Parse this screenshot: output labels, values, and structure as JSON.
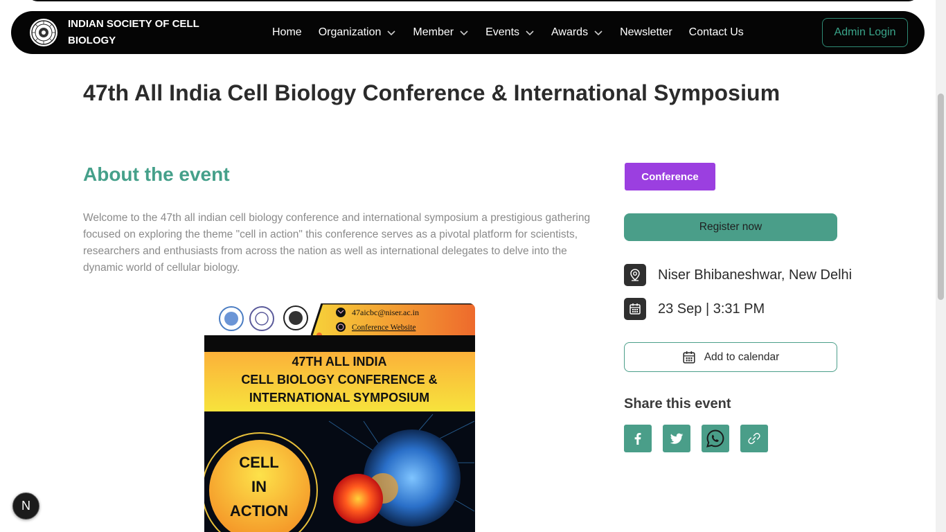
{
  "header": {
    "brand_name": "INDIAN SOCIETY OF CELL BIOLOGY",
    "nav": [
      {
        "label": "Home",
        "dropdown": false
      },
      {
        "label": "Organization",
        "dropdown": true
      },
      {
        "label": "Member",
        "dropdown": true
      },
      {
        "label": "Events",
        "dropdown": true
      },
      {
        "label": "Awards",
        "dropdown": true
      },
      {
        "label": "Newsletter",
        "dropdown": false
      },
      {
        "label": "Contact Us",
        "dropdown": false
      }
    ],
    "admin_login": "Admin Login"
  },
  "event": {
    "title": "47th All India Cell Biology Conference & International Symposium",
    "about_heading": "About the event",
    "description": "Welcome to the 47th all indian cell biology conference and international symposium a prestigious gathering focused on exploring the theme \"cell in action\" this conference serves as a pivotal platform for scientists, researchers and enthusiasts from across the nation as well as international delegates to delve into the dynamic world of cellular biology.",
    "category": "Conference",
    "register_label": "Register now",
    "location": "Niser Bhibaneshwar, New Delhi",
    "datetime": "23 Sep | 3:31 PM",
    "add_calendar_label": "Add to calendar",
    "share_heading": "Share this event",
    "share_icons": [
      "facebook-icon",
      "twitter-icon",
      "whatsapp-icon",
      "link-icon"
    ]
  },
  "poster": {
    "email": "47aicbc@niser.ac.in",
    "website_label": "Conference Website",
    "line1": "47TH ALL INDIA",
    "line2": "CELL BIOLOGY CONFERENCE &",
    "line3": "INTERNATIONAL SYMPOSIUM",
    "theme_1": "CELL",
    "theme_2": "IN",
    "theme_3": "ACTION"
  },
  "overlay": {
    "n_badge": "N"
  },
  "colors": {
    "accent": "#4a9e89",
    "badge_purple": "#9b3fe0",
    "nav_bg": "#050505",
    "heading_green": "#45a08a"
  }
}
